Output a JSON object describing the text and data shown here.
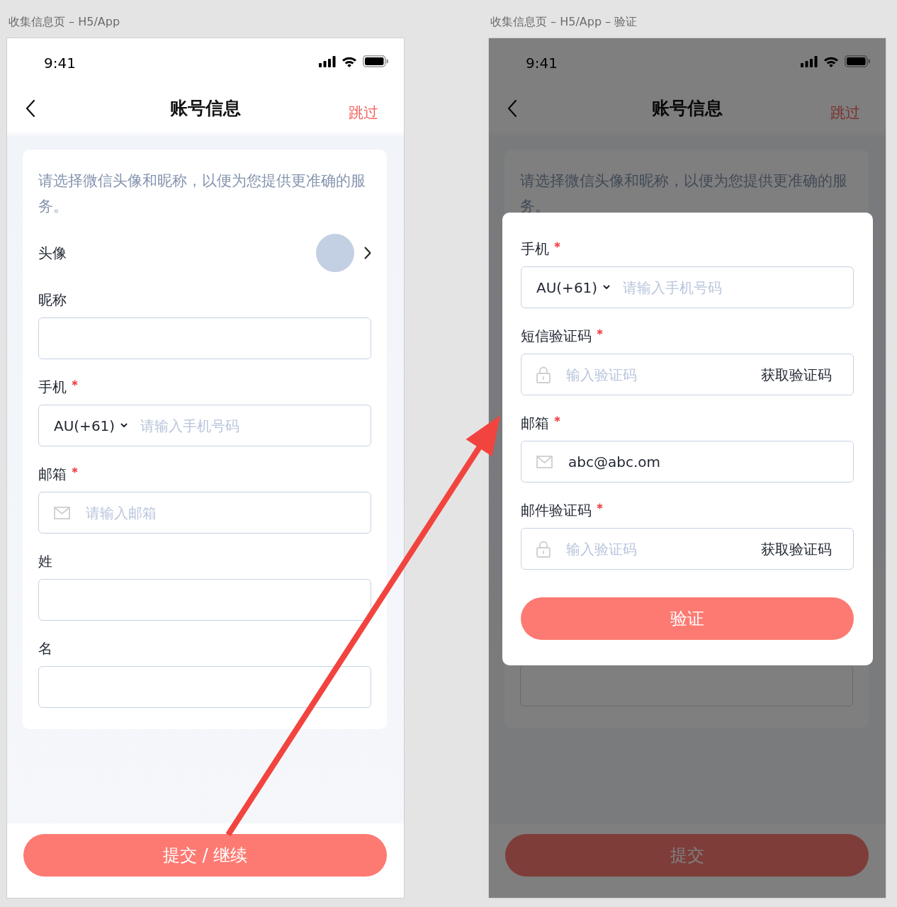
{
  "frames": [
    {
      "caption": "收集信息页 – H5/App",
      "time": "9:41",
      "title": "账号信息",
      "skip": "跳过",
      "intro": "请选择微信头像和昵称，以便为您提供更准确的服务。",
      "dimmed": false,
      "fields": [
        {
          "kind": "avatar",
          "label": "头像"
        },
        {
          "kind": "text",
          "label": "昵称",
          "required": false
        },
        {
          "kind": "phone",
          "label": "手机",
          "required": true,
          "country": "AU(+61)",
          "placeholder": "请输入手机号码"
        },
        {
          "kind": "email",
          "label": "邮箱",
          "required": true,
          "placeholder": "请输入邮箱"
        },
        {
          "kind": "text",
          "label": "姓",
          "required": false
        },
        {
          "kind": "text",
          "label": "名",
          "required": false
        }
      ],
      "submit": "提交 / 继续"
    },
    {
      "caption": "收集信息页 – H5/App – 验证",
      "time": "9:41",
      "title": "账号信息",
      "skip": "跳过",
      "intro": "请选择微信头像和昵称，以便为您提供更准确的服务。",
      "dimmed": true,
      "fields": [
        {
          "kind": "text"
        }
      ],
      "submit": "提交",
      "dialog": {
        "fields": [
          {
            "kind": "phone",
            "label": "手机",
            "required": true,
            "country": "AU(+61)",
            "placeholder": "请输入手机号码"
          },
          {
            "kind": "code",
            "label": "短信验证码",
            "required": true,
            "placeholder": "输入验证码",
            "action": "获取验证码"
          },
          {
            "kind": "email",
            "label": "邮箱",
            "required": true,
            "value": "abc@abc.om"
          },
          {
            "kind": "code",
            "label": "邮件验证码",
            "required": true,
            "placeholder": "输入验证码",
            "action": "获取验证码"
          }
        ],
        "button": "验证"
      }
    }
  ]
}
